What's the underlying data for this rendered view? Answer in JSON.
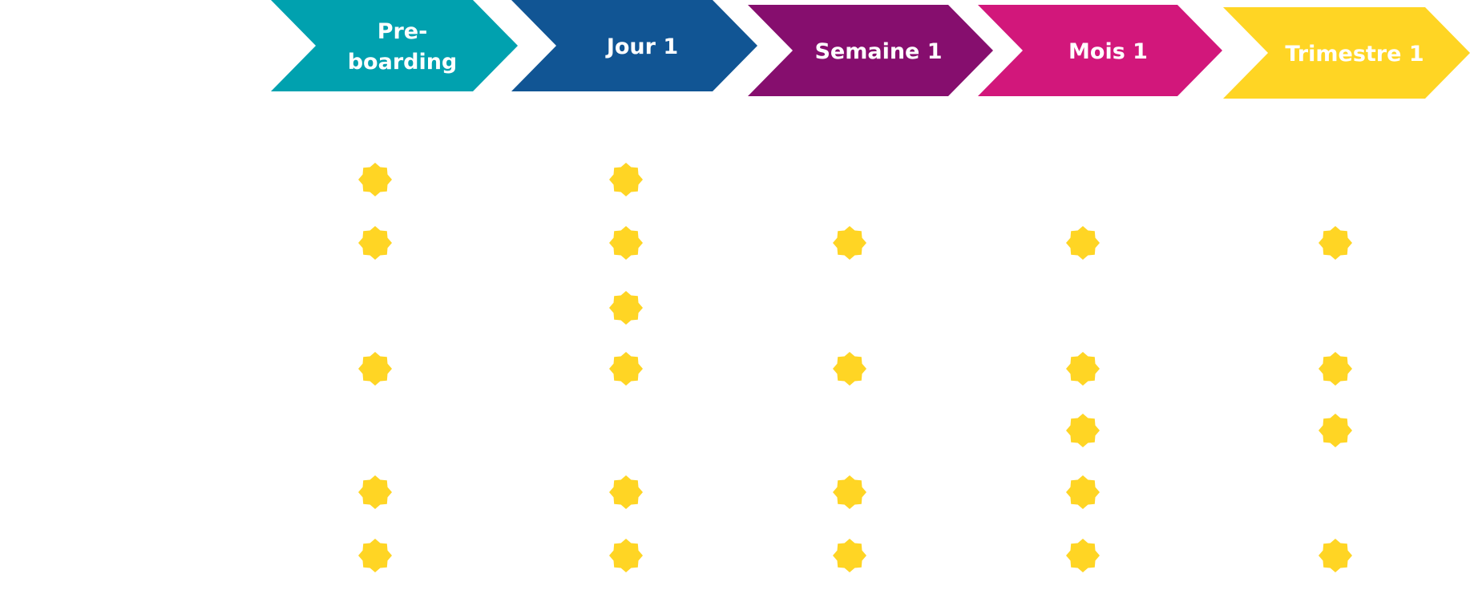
{
  "diagram": {
    "title": "",
    "colors": {
      "star": "#FFD524",
      "background": "#FFFFFF",
      "label_text": "#FFFFFF"
    },
    "phases": [
      {
        "id": "preboarding",
        "label_lines": [
          "Pre-",
          "boarding"
        ],
        "color": "#00A1AF"
      },
      {
        "id": "jour1",
        "label_lines": [
          "Jour 1"
        ],
        "color": "#115594"
      },
      {
        "id": "semaine1",
        "label_lines": [
          "Semaine 1"
        ],
        "color": "#860E6E"
      },
      {
        "id": "mois1",
        "label_lines": [
          "Mois 1"
        ],
        "color": "#D2177B"
      },
      {
        "id": "trimestre1",
        "label_lines": [
          "Trimestre 1"
        ],
        "color": "#FFD524"
      }
    ],
    "row_count": 7,
    "matrix_note": "1 = star marker present for that row/phase",
    "matrix": [
      [
        1,
        1,
        0,
        0,
        0
      ],
      [
        1,
        1,
        1,
        1,
        1
      ],
      [
        0,
        1,
        0,
        0,
        0
      ],
      [
        1,
        1,
        1,
        1,
        1
      ],
      [
        0,
        0,
        0,
        1,
        1
      ],
      [
        1,
        1,
        1,
        1,
        0
      ],
      [
        1,
        1,
        1,
        1,
        1
      ]
    ],
    "marker_icon": "eight-point-star-icon"
  }
}
